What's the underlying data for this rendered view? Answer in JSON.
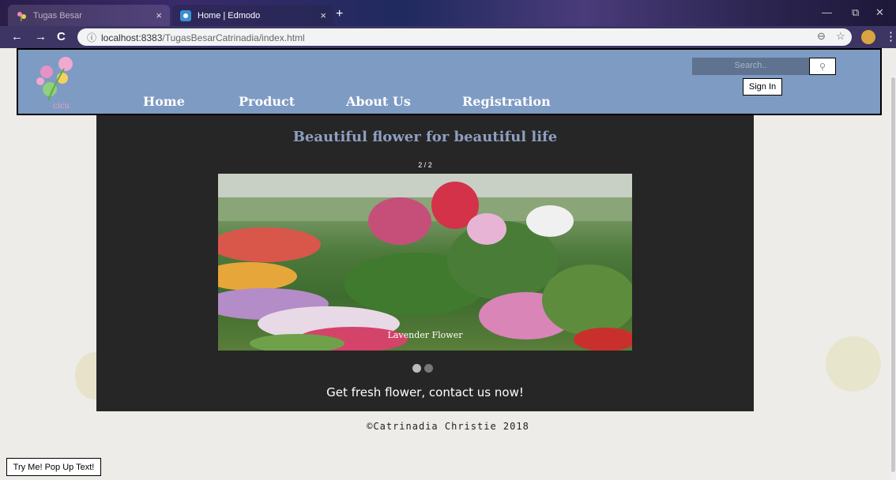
{
  "browser": {
    "tabs": [
      {
        "label": "Tugas Besar",
        "close": "×"
      },
      {
        "label": "Home | Edmodo",
        "close": "×"
      }
    ],
    "new_tab": "+",
    "url_host": "localhost:8383",
    "url_path": "/TugasBesarCatrinadia/index.html",
    "info_icon": "ⓘ",
    "back": "←",
    "forward": "→",
    "reload": "C",
    "zoom_icon": "⊖",
    "star_icon": "☆",
    "menu_icon": "⋮",
    "minimize": "—",
    "restore": "⧉",
    "close_window": "✕"
  },
  "header": {
    "logo_text": "cicu",
    "nav": [
      "Home",
      "Product",
      "About Us",
      "Registration"
    ],
    "search_placeholder": "Search..",
    "search_icon": "⚲",
    "signin_label": "Sign In"
  },
  "main": {
    "tagline": "Beautiful flower for beautiful life",
    "counter": "2 / 2",
    "slide_caption": "Lavender Flower",
    "cta": "Get fresh flower, contact us now!"
  },
  "footer": {
    "copyright": "©Catrinadia Christie 2018"
  },
  "popup_button": "Try Me! Pop Up Text!",
  "colors": {
    "header_bg": "#7e9bc3",
    "main_bg": "#262626",
    "tagline": "#8e9fc0"
  }
}
